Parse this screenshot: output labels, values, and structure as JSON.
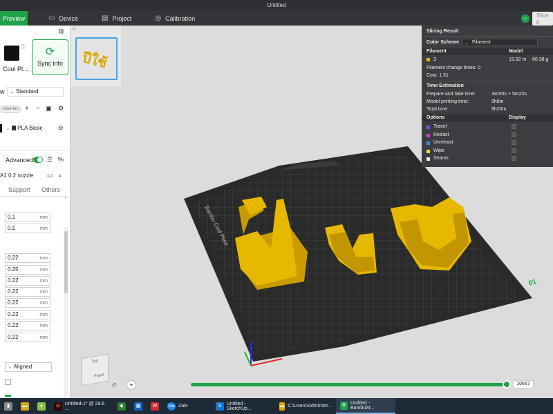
{
  "window": {
    "title": "Untitled"
  },
  "tabs": [
    {
      "label": "Preview"
    },
    {
      "label": "Device"
    },
    {
      "label": "Project"
    },
    {
      "label": "Calibration"
    }
  ],
  "slice_button": {
    "label": "Slice p"
  },
  "left_panel": {
    "filament_label": "Cool Pl...",
    "sync_label": "Sync info",
    "process_prefix": "w",
    "process_value": "Standard",
    "volumes_label": "volumes",
    "plate_filament": "PLA Basic",
    "advanced_label": "Advanced",
    "nozzle": "A1 0.2 nozzle",
    "tab_support": "Support",
    "tab_others": "Others",
    "fields": [
      {
        "value": "0.1",
        "unit": "mm"
      },
      {
        "value": "0.1",
        "unit": "mm"
      },
      {
        "value": "0.22",
        "unit": "mm"
      },
      {
        "value": "0.25",
        "unit": "mm"
      },
      {
        "value": "0.22",
        "unit": "mm"
      },
      {
        "value": "0.22",
        "unit": "mm"
      },
      {
        "value": "0.22",
        "unit": "mm"
      },
      {
        "value": "0.22",
        "unit": "mm"
      },
      {
        "value": "0.22",
        "unit": "mm"
      },
      {
        "value": "0.22",
        "unit": "mm"
      }
    ],
    "seam_value": "Aligned"
  },
  "thumbnail": {
    "index": "1"
  },
  "slicing_result": {
    "title": "Slicing Result",
    "color_scheme_label": "Color Scheme",
    "color_scheme_value": "Filament",
    "col_filament": "Filament",
    "col_model": "Model",
    "filament_id": "3",
    "model_length": "19.92 m",
    "model_weight": "60.38 g",
    "change_times": "Filament change times:  0",
    "cost": "Cost:  1.51",
    "time_title": "Time Estimation",
    "prepare_label": "Prepare and take time:",
    "prepare_value": "6m55s + 5m22s",
    "model_time_label": "Model printing time:",
    "model_time_value": "9h8m",
    "total_label": "Total time:",
    "total_value": "9h20m",
    "options_label": "Options",
    "display_label": "Display",
    "options": [
      {
        "label": "Travel",
        "color": "#6b5bd6",
        "checked": false
      },
      {
        "label": "Retract",
        "color": "#d23bd2",
        "checked": false
      },
      {
        "label": "Unretract",
        "color": "#3b8fd6",
        "checked": false
      },
      {
        "label": "Wipe",
        "color": "#f0e030",
        "checked": false
      },
      {
        "label": "Seams",
        "color": "#e8e8e8",
        "checked": true
      }
    ]
  },
  "plate": {
    "label": "Bambu Cool Plate",
    "text": "ปีใช้",
    "number": "01"
  },
  "cube": {
    "top": "Top",
    "front": "Front"
  },
  "layer_slider": {
    "value": "10667"
  },
  "colors": {
    "accent": "#1fa34a",
    "filament": "#e6b800"
  },
  "taskbar": [
    {
      "label": "Untitled-1* @ 29.6 ..."
    },
    {
      "label": "Zalo"
    },
    {
      "label": "Untitled - SketchUp..."
    },
    {
      "label": "C:\\Users\\Administr..."
    },
    {
      "label": "Untitled - BambuSt..."
    }
  ]
}
